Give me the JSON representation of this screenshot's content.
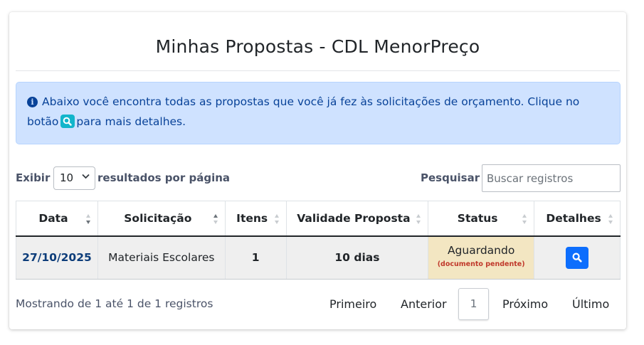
{
  "page": {
    "title": "Minhas Propostas - CDL MenorPreço"
  },
  "alert": {
    "text_before": "Abaixo você encontra todas as propostas que você já fez às solicitações de orçamento. Clique no botão",
    "text_after": "para mais detalhes."
  },
  "controls": {
    "show_prefix": "Exibir",
    "page_size": "10",
    "show_suffix": "resultados por página",
    "search_label": "Pesquisar",
    "search_placeholder": "Buscar registros"
  },
  "table": {
    "columns": [
      "Data",
      "Solicitação",
      "Itens",
      "Validade Proposta",
      "Status",
      "Detalhes"
    ],
    "rows": [
      {
        "date": "27/10/2025",
        "request": "Materiais Escolares",
        "items": "1",
        "validity": "10 dias",
        "status": "Aguardando",
        "status_note": "(documento pendente)"
      }
    ]
  },
  "footer": {
    "info": "Mostrando de 1 até 1 de 1 registros",
    "first": "Primeiro",
    "previous": "Anterior",
    "current_page": "1",
    "next": "Próximo",
    "last": "Último"
  },
  "colors": {
    "alert_bg": "#cfe2ff",
    "alert_text": "#084298",
    "status_bg": "#f3e6c2",
    "status_note": "#c0392b",
    "detail_button": "#0d6efd",
    "date_text": "#0d3d7a"
  },
  "icons": {
    "alert": "info-circle-icon",
    "inline": "search-icon",
    "detail": "search-icon",
    "sort": "sort-arrows-icon"
  }
}
